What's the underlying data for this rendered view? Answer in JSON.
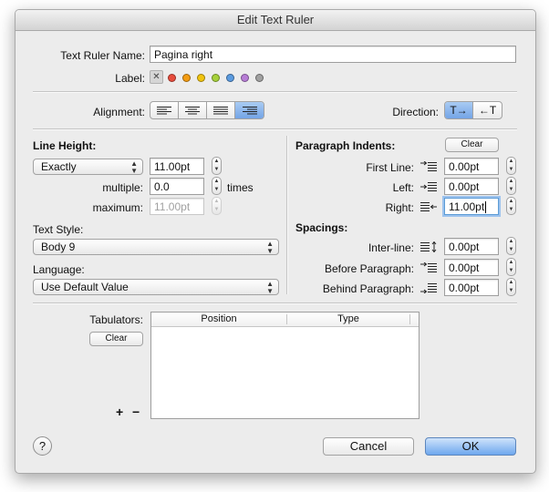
{
  "window": {
    "title": "Edit Text Ruler"
  },
  "ruler_name": {
    "label": "Text Ruler Name:",
    "value": "Pagina right"
  },
  "label_row": {
    "label": "Label:",
    "clear_glyph": "✕",
    "colors": [
      "#e74c3c",
      "#f39c12",
      "#f1c40f",
      "#a6d13a",
      "#5b9be0",
      "#b77dd6",
      "#a0a0a0"
    ]
  },
  "alignment": {
    "label": "Alignment:",
    "selected": 3
  },
  "direction": {
    "label": "Direction:",
    "ltr": "T→",
    "rtl": "←T"
  },
  "line_height": {
    "heading": "Line Height:",
    "mode": "Exactly",
    "value": "11.00pt",
    "multiple_label": "multiple:",
    "multiple_value": "0.0",
    "times": "times",
    "maximum_label": "maximum:",
    "maximum_value": "11.00pt"
  },
  "text_style": {
    "label": "Text Style:",
    "value": "Body 9"
  },
  "language": {
    "label": "Language:",
    "value": "Use Default Value"
  },
  "indents": {
    "heading": "Paragraph Indents:",
    "clear": "Clear",
    "first_line": {
      "label": "First Line:",
      "value": "0.00pt"
    },
    "left": {
      "label": "Left:",
      "value": "0.00pt"
    },
    "right": {
      "label": "Right:",
      "value": "11.00pt"
    }
  },
  "spacings": {
    "heading": "Spacings:",
    "inter_line": {
      "label": "Inter-line:",
      "value": "0.00pt"
    },
    "before": {
      "label": "Before Paragraph:",
      "value": "0.00pt"
    },
    "behind": {
      "label": "Behind Paragraph:",
      "value": "0.00pt"
    }
  },
  "tabulators": {
    "label": "Tabulators:",
    "clear": "Clear",
    "add": "+",
    "remove": "−",
    "columns": [
      "Position",
      "Type"
    ]
  },
  "footer": {
    "help": "?",
    "cancel": "Cancel",
    "ok": "OK"
  }
}
